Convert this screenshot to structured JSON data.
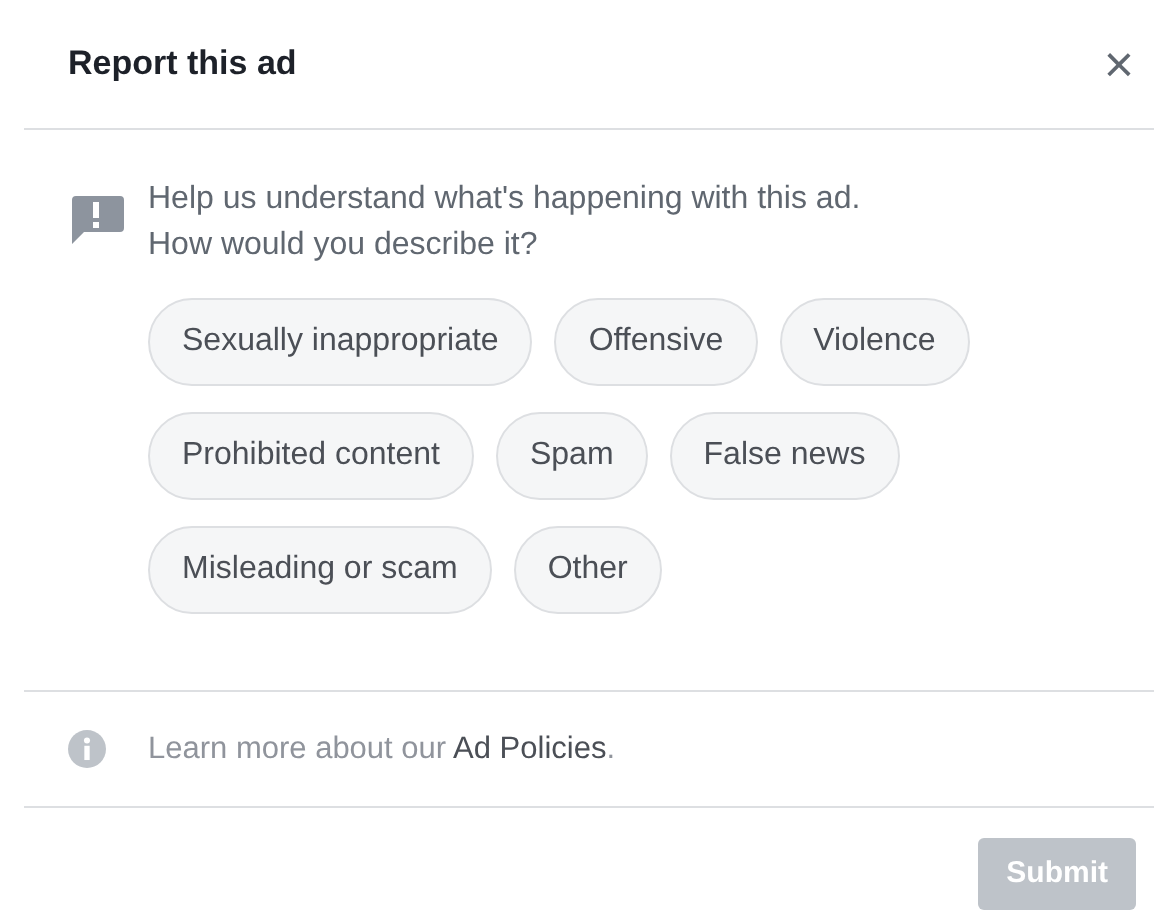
{
  "dialog": {
    "title": "Report this ad",
    "close": "×"
  },
  "prompt": {
    "lines": [
      "Help us understand what's happening with this ad.",
      "How would you describe it?"
    ]
  },
  "options": [
    {
      "label": "Sexually inappropriate",
      "selected": false
    },
    {
      "label": "Offensive",
      "selected": false
    },
    {
      "label": "Violence",
      "selected": false
    },
    {
      "label": "Prohibited content",
      "selected": false
    },
    {
      "label": "Spam",
      "selected": false
    },
    {
      "label": "False news",
      "selected": false
    },
    {
      "label": "Misleading or scam",
      "selected": false
    },
    {
      "label": "Other",
      "selected": false
    }
  ],
  "footer": {
    "text": "Learn more about our ",
    "link": "Ad Policies",
    "after": "."
  },
  "submit": {
    "label": "Submit",
    "disabled": true
  }
}
